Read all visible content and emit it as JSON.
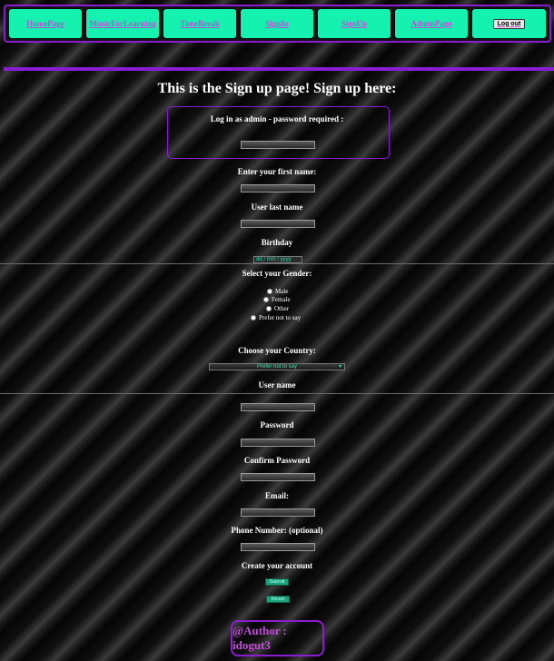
{
  "nav": {
    "items": [
      "HomePage",
      "MusicForLearning",
      "TimeBreak",
      "SignIn",
      "SignUp",
      "AdminPage"
    ],
    "logout_label": "Log out"
  },
  "page": {
    "title": "This is the Sign up page! Sign up here:"
  },
  "form": {
    "admin_label": "Log in as admin - password required :",
    "first_name_label": "Enter your first name:",
    "last_name_label": "User last name",
    "birthday_label": "Birthday",
    "birthday_placeholder": "dd / mm / yyyy",
    "gender_label": "Select your Gender:",
    "gender_options": [
      "Male",
      "Female",
      "Other",
      "Prefer not to say"
    ],
    "country_label": "Choose your Country:",
    "country_selected": "Prefer not to say",
    "username_label": "User name",
    "password_label": "Password",
    "confirm_password_label": "Confirm Password",
    "email_label": "Email:",
    "phone_label": "Phone Number: (optional)",
    "create_label": "Create your account",
    "submit_label": "Submit",
    "reset_label": "Reset"
  },
  "footer": {
    "author": "@Author : idogut3"
  },
  "colors": {
    "nav_bg": "#15f2b0",
    "accent": "#8a1dcf",
    "link": "#c24dd8"
  }
}
